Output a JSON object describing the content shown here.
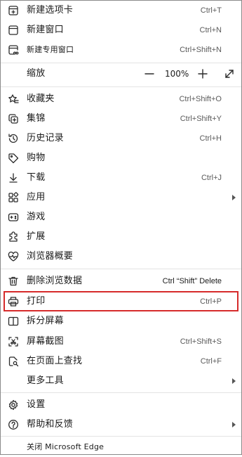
{
  "menu": {
    "new_tab": {
      "label": "新建选项卡",
      "shortcut": "Ctrl+T"
    },
    "new_window": {
      "label": "新建窗口",
      "shortcut": "Ctrl+N"
    },
    "new_private": {
      "label": "新建专用窗口",
      "shortcut": "Ctrl+Shift+N"
    },
    "zoom": {
      "label": "缩放",
      "minus": "—",
      "value": "100%",
      "plus": "+"
    },
    "favorites": {
      "label": "收藏夹",
      "shortcut": "Ctrl+Shift+O"
    },
    "collections": {
      "label": "集锦",
      "shortcut": "Ctrl+Shift+Y"
    },
    "history": {
      "label": "历史记录",
      "shortcut": "Ctrl+H"
    },
    "shopping": {
      "label": "购物"
    },
    "downloads": {
      "label": "下载",
      "shortcut": "Ctrl+J"
    },
    "apps": {
      "label": "应用"
    },
    "games": {
      "label": "游戏"
    },
    "extensions": {
      "label": "扩展"
    },
    "browser_essentials": {
      "label": "浏览器概要"
    },
    "clear_data": {
      "label": "删除浏览数据",
      "shortcut": "Ctrl “Shift” Delete"
    },
    "print": {
      "label": "打印",
      "shortcut": "Ctrl+P"
    },
    "split_screen": {
      "label": "拆分屏幕"
    },
    "screenshot": {
      "label": "屏幕截图",
      "shortcut": "Ctrl+Shift+S"
    },
    "find": {
      "label": "在页面上查找",
      "shortcut": "Ctrl+F"
    },
    "more_tools": {
      "label": "更多工具"
    },
    "settings": {
      "label": "设置"
    },
    "help": {
      "label": "帮助和反馈"
    },
    "close": {
      "label": "关闭 Microsoft Edge"
    }
  },
  "colors": {
    "highlight": "#d62b2b",
    "divider": "#e3e3e3",
    "border": "#8a8a8a"
  }
}
